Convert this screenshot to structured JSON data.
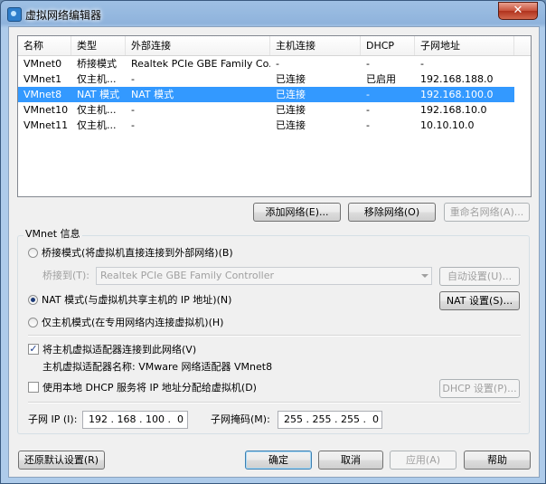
{
  "window": {
    "title": "虚拟网络编辑器",
    "close_glyph": "✕"
  },
  "table": {
    "columns": [
      "名称",
      "类型",
      "外部连接",
      "主机连接",
      "DHCP",
      "子网地址"
    ],
    "rows": [
      [
        "VMnet0",
        "桥接模式",
        "Realtek PCIe GBE Family Co...",
        "-",
        "-",
        "-"
      ],
      [
        "VMnet1",
        "仅主机...",
        "-",
        "已连接",
        "已启用",
        "192.168.188.0"
      ],
      [
        "VMnet8",
        "NAT 模式",
        "NAT 模式",
        "已连接",
        "-",
        "192.168.100.0"
      ],
      [
        "VMnet10",
        "仅主机...",
        "-",
        "已连接",
        "-",
        "192.168.10.0"
      ],
      [
        "VMnet11",
        "仅主机...",
        "-",
        "已连接",
        "-",
        "10.10.10.0"
      ]
    ],
    "selected_row": 2
  },
  "list_buttons": {
    "add": "添加网络(E)...",
    "remove": "移除网络(O)",
    "rename": "重命名网络(A)..."
  },
  "vmnet_info": {
    "title": "VMnet 信息",
    "bridge_radio": "桥接模式(将虚拟机直接连接到外部网络)(B)",
    "bridge_to_label": "桥接到(T):",
    "bridge_to_value": "Realtek PCIe GBE Family Controller",
    "auto_settings": "自动设置(U)...",
    "nat_radio": "NAT 模式(与虚拟机共享主机的 IP 地址)(N)",
    "nat_settings": "NAT 设置(S)...",
    "host_only_radio": "仅主机模式(在专用网络内连接虚拟机)(H)",
    "selected_mode": "nat",
    "connect_adapter_check": "将主机虚拟适配器连接到此网络(V)",
    "connect_adapter_checked": true,
    "adapter_name": "主机虚拟适配器名称: VMware 网络适配器 VMnet8",
    "dhcp_check": "使用本地 DHCP 服务将 IP 地址分配给虚拟机(D)",
    "dhcp_checked": false,
    "dhcp_settings": "DHCP 设置(P)...",
    "subnet_ip_label": "子网 IP (I):",
    "subnet_ip": "192 . 168 . 100 .  0",
    "subnet_mask_label": "子网掩码(M):",
    "subnet_mask": "255 . 255 . 255 .  0"
  },
  "bottom_buttons": {
    "restore": "还原默认设置(R)",
    "ok": "确定",
    "cancel": "取消",
    "apply": "应用(A)",
    "help": "帮助"
  }
}
